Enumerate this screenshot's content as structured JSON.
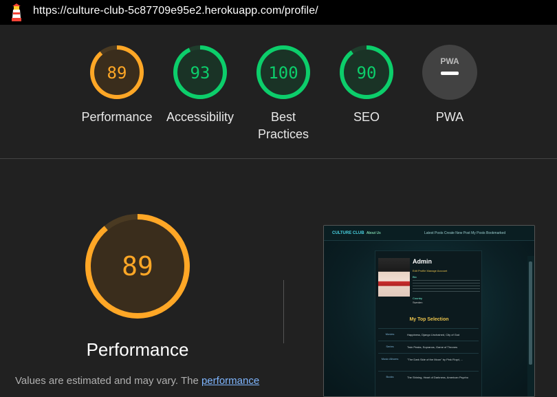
{
  "browser": {
    "url": "https://culture-club-5c87709e95e2.herokuapp.com/profile/",
    "icon": "lighthouse-icon"
  },
  "summary": {
    "gauges": [
      {
        "label": "Performance",
        "value": "89",
        "score": 0.89,
        "color": "#ffa726"
      },
      {
        "label": "Accessibility",
        "value": "93",
        "score": 0.93,
        "color": "#0cce6b"
      },
      {
        "label": "Best Practices",
        "value": "100",
        "score": 1.0,
        "color": "#0cce6b"
      },
      {
        "label": "SEO",
        "value": "90",
        "score": 0.9,
        "color": "#0cce6b"
      },
      {
        "label": "PWA",
        "value": "PWA",
        "score": 0,
        "color": "#9e9e9e"
      }
    ]
  },
  "performance": {
    "score": "89",
    "score_fraction": 0.89,
    "title": "Performance",
    "desc_prefix": "Values are estimated and may vary. The ",
    "desc_link": "performance",
    "color": "#ffa726"
  },
  "thumbnail": {
    "brand": "CULTURE CLUB",
    "about": "About Us",
    "nav_right": "Latest Posts   Create New Post   My Posts   Bookmarked",
    "name": "Admin",
    "links": "Edit Profile   Manage Account",
    "bio_heading": "Bio",
    "country_heading": "Country",
    "country_value": "Sweden",
    "selection_title": "My Top Selection",
    "rows": [
      {
        "key": "Movies",
        "value": "Happiness, Django Unchained, City of God"
      },
      {
        "key": "Series",
        "value": "Twin Peaks, Sopranos, Game of Thrones"
      },
      {
        "key": "Music Albums",
        "value": "\"The Dark Side of the Moon\" by Pink Floyd, ..."
      },
      {
        "key": "Books",
        "value": "The Shining, Heart of Darkness, American Psycho"
      }
    ]
  }
}
